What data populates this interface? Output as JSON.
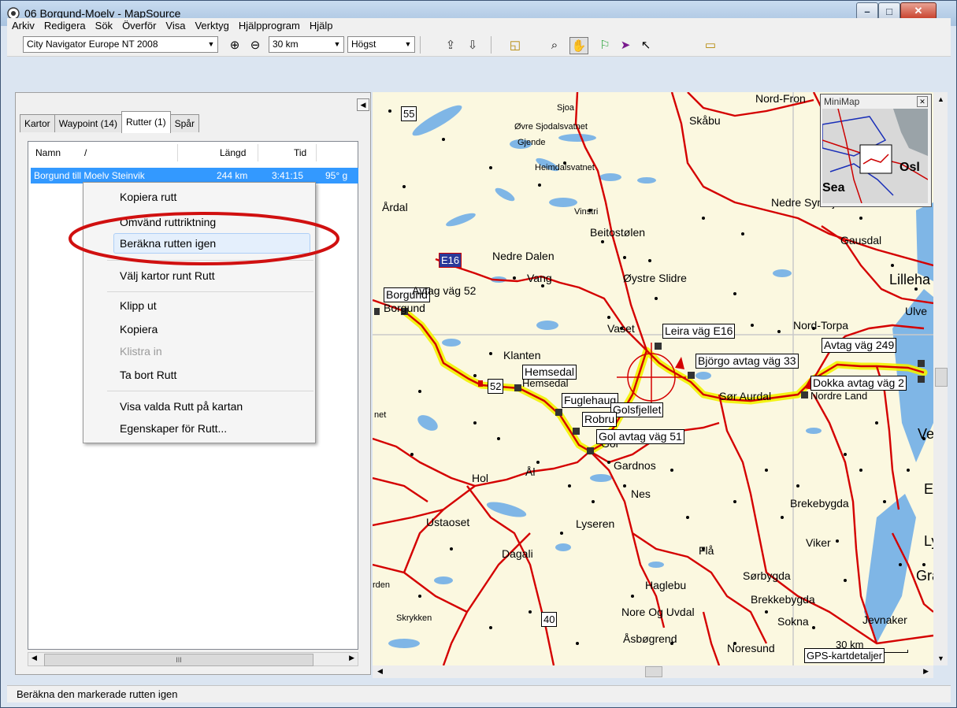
{
  "window": {
    "title": "06 Borgund-Moelv - MapSource"
  },
  "menu": [
    "Arkiv",
    "Redigera",
    "Sök",
    "Överför",
    "Visa",
    "Verktyg",
    "Hjälpprogram",
    "Hjälp"
  ],
  "toolbar": {
    "map_product": "City Navigator Europe NT 2008",
    "scale": "30 km",
    "detail": "Högst"
  },
  "tabs": [
    "Kartor",
    "Waypoint (14)",
    "Rutter (1)",
    "Spår"
  ],
  "list": {
    "headers": {
      "name": "Namn",
      "sort": "/",
      "length": "Längd",
      "time": "Tid"
    },
    "row": {
      "name": "Borgund till Moelv Steinvik",
      "length": "244 km",
      "time": "3:41:15",
      "extra": "95° g"
    }
  },
  "context_menu": [
    "Kopiera rutt",
    "Omvänd ruttriktning",
    "Beräkna rutten igen",
    "Välj kartor runt Rutt",
    "Klipp ut",
    "Kopiera",
    "Klistra in",
    "Ta bort Rutt",
    "Visa valda Rutt på kartan",
    "Egenskaper för Rutt..."
  ],
  "context_menu_disabled": "Klistra in",
  "scroll": {
    "left_label": "III"
  },
  "minimap": {
    "title": "MiniMap",
    "sea": "Sea",
    "osl": "Osl"
  },
  "map": {
    "labels": {
      "sjoa": "Sjoa",
      "ovre": "Øvre Sjodalsvatnet",
      "gjende": "Gjende",
      "heimdal": "Heimdalsvatnet",
      "skabu": "Skåbu",
      "nordfron": "Nord-Fron",
      "ardal": "Årdal",
      "vinstri": "Vinstri",
      "beito": "Beitostølen",
      "nedresy": "Nedre Synnfjorden",
      "gausdal": "Gausdal",
      "nedredalen": "Nedre Dalen",
      "vang": "Vang",
      "oystre": "Øystre Slidre",
      "lilleh": "Lilleha",
      "vaset": "Vaset",
      "ulve": "Ulve",
      "nordtorpa": "Nord-Torpa",
      "klanten": "Klanten",
      "hemsedal_txt": "Hemsedal",
      "soraurdal": "Sør Aurdal",
      "nordre": "Nordre Land",
      "net": "net",
      "hol": "Hol",
      "al": "Ål",
      "gardnos": "Gardnos",
      "nes": "Nes",
      "ustaoset": "Ustaoset",
      "lyseren": "Lyseren",
      "brekebygda": "Brekebygda",
      "viker": "Viker",
      "dagali": "Dagali",
      "fla": "Flå",
      "sorbygda": "Sørbygda",
      "haglebu": "Haglebu",
      "rden": "rden",
      "brekke": "Brekkebygda",
      "skrykken": "Skrykken",
      "norevdal": "Nore Og Uvdal",
      "sokna": "Sokna",
      "jevnaker": "Jevnaker",
      "asbo": "Åsbøgrend",
      "noresund": "Noresund",
      "gra": "Gra",
      "ly": "Ly",
      "ei": "Ei",
      "ve": "Ve",
      "gol": "Gol",
      "golsfjellet": "Golsfjellet",
      "fuglehaug_under": "Fuglehaug"
    },
    "boxes": {
      "borgund": "Borgund",
      "borgund_town": "Borgund",
      "avtag52": "Avtag väg 52",
      "leira": "Leira väg E16",
      "bjorgo": "Björgo avtag väg 33",
      "avtag249": "Avtag väg 249",
      "dokka": "Dokka avtag väg 2",
      "hemsedal": "Hemsedal",
      "fuglehaug": "Fuglehaug",
      "robru": "Robru",
      "golsfjellet": "Golsfjellet",
      "golavtag": "Gol avtag väg 51",
      "gps": "GPS-kartdetaljer",
      "scalebar": "30 km"
    },
    "shields": {
      "r55": "55",
      "e16": "E16",
      "r52": "52",
      "r40": "40"
    }
  },
  "status": "Beräkna den markerade rutten igen"
}
